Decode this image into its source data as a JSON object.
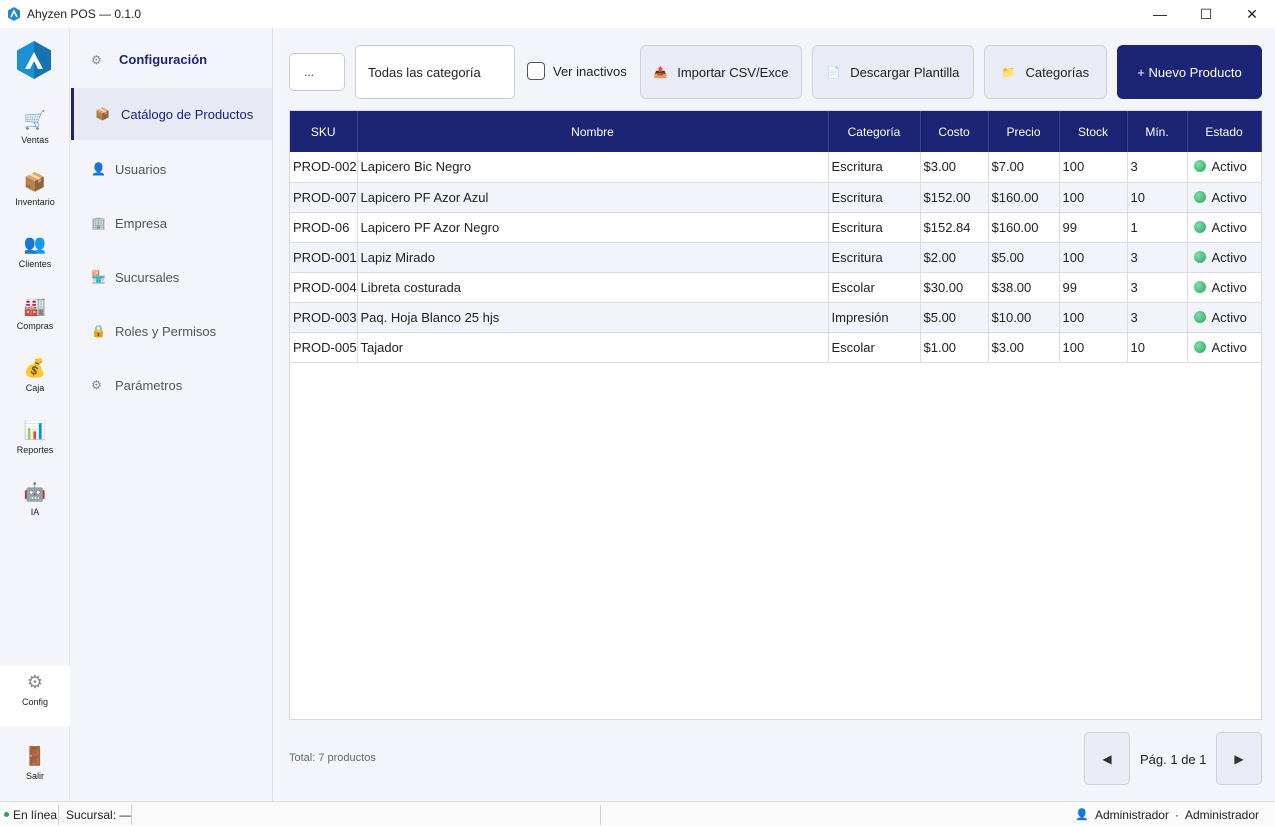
{
  "window": {
    "title": "Ahyzen POS — 0.1.0",
    "minimize": "—",
    "maximize": "☐",
    "close": "✕"
  },
  "rail": {
    "items": [
      {
        "label": "Ventas",
        "icon": "🛒"
      },
      {
        "label": "Inventario",
        "icon": "📦"
      },
      {
        "label": "Clientes",
        "icon": "👥"
      },
      {
        "label": "Compras",
        "icon": "🏭"
      },
      {
        "label": "Caja",
        "icon": "💰"
      },
      {
        "label": "Reportes",
        "icon": "📊"
      },
      {
        "label": "IA",
        "icon": "🤖"
      }
    ],
    "config": {
      "label": "Config",
      "icon": "⚙"
    },
    "exit": {
      "label": "Salir",
      "icon": "🚪"
    }
  },
  "subnav": {
    "header": {
      "label": "Configuración",
      "icon": "⚙"
    },
    "items": [
      {
        "label": "Catálogo de Productos",
        "icon": "📦"
      },
      {
        "label": "Usuarios",
        "icon": "👤"
      },
      {
        "label": "Empresa",
        "icon": "🏢"
      },
      {
        "label": "Sucursales",
        "icon": "🏪"
      },
      {
        "label": "Roles y Permisos",
        "icon": "🔒"
      },
      {
        "label": "Parámetros",
        "icon": "⚙"
      }
    ]
  },
  "toolbar": {
    "search_value": "...",
    "category_value": "Todas las categoría",
    "show_inactive_label": "Ver inactivos",
    "import_label": "Importar CSV/Exce",
    "import_icon": "📤",
    "template_label": "Descargar Plantilla",
    "template_icon": "📄",
    "categories_label": "Categorías",
    "categories_icon": "📁",
    "new_product_label": "+ Nuevo Producto"
  },
  "table": {
    "columns": [
      "SKU",
      "Nombre",
      "Categoría",
      "Costo",
      "Precio",
      "Stock",
      "Mín.",
      "Estado"
    ],
    "rows": [
      [
        "PROD-002",
        "Lapicero Bic Negro",
        "Escritura",
        "$3.00",
        "$7.00",
        "100",
        "3",
        "Activo"
      ],
      [
        "PROD-007",
        "Lapicero PF Azor Azul",
        "Escritura",
        "$152.00",
        "$160.00",
        "100",
        "10",
        "Activo"
      ],
      [
        "PROD-06",
        "Lapicero PF Azor Negro",
        "Escritura",
        "$152.84",
        "$160.00",
        "99",
        "1",
        "Activo"
      ],
      [
        "PROD-001",
        "Lapiz Mirado",
        "Escritura",
        "$2.00",
        "$5.00",
        "100",
        "3",
        "Activo"
      ],
      [
        "PROD-004",
        "Libreta costurada",
        "Escolar",
        "$30.00",
        "$38.00",
        "99",
        "3",
        "Activo"
      ],
      [
        "PROD-003",
        "Paq. Hoja Blanco 25 hjs",
        "Impresión",
        "$5.00",
        "$10.00",
        "100",
        "3",
        "Activo"
      ],
      [
        "PROD-005",
        "Tajador",
        "Escolar",
        "$1.00",
        "$3.00",
        "100",
        "10",
        "Activo"
      ]
    ]
  },
  "footer": {
    "total": "Total: 7 productos",
    "page": "Pág. 1 de 1",
    "prev": "◀",
    "next": "▶"
  },
  "statusbar": {
    "online": "En línea",
    "branch": "Sucursal: —",
    "user_icon": "👤",
    "user": "Administrador",
    "separator": "·",
    "role": "Administrador"
  },
  "colors": {
    "primary": "#1c2475",
    "active_dot": "#2ba35f"
  }
}
